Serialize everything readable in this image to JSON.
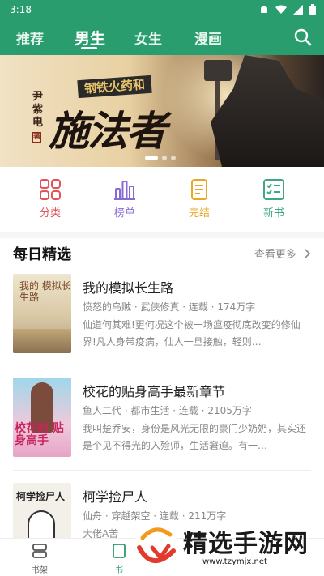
{
  "status_bar": {
    "time": "3:18"
  },
  "nav": {
    "tabs": [
      {
        "label": "推荐"
      },
      {
        "label": "男生"
      },
      {
        "label": "女生"
      },
      {
        "label": "漫画"
      }
    ],
    "active_tab": "男生"
  },
  "banner": {
    "ribbon": "钢铁火药和",
    "title": "施法者",
    "author": "尹紫电",
    "author_seal": "著",
    "dots": 3,
    "active_dot": 1
  },
  "quick_nav": [
    {
      "label": "分类",
      "icon": "grid-icon",
      "color": "#e0545a"
    },
    {
      "label": "榜单",
      "icon": "bar-chart-icon",
      "color": "#8a6bd6"
    },
    {
      "label": "完结",
      "icon": "document-icon",
      "color": "#e6a826"
    },
    {
      "label": "新书",
      "icon": "checklist-icon",
      "color": "#3fa882"
    }
  ],
  "section": {
    "title": "每日精选",
    "see_more": "查看更多"
  },
  "books": [
    {
      "title": "我的模拟长生路",
      "meta": "愤怒的乌贼 · 武侠修真 · 连载 · 174万字",
      "desc": "仙道何其难!更何况这个被一场瘟疫彻底改变的修仙界!凡人身带疫病，仙人一旦接触，轻则…",
      "cover_text": "我的 模拟长生路"
    },
    {
      "title": "校花的贴身高手最新章节",
      "meta": "鱼人二代 · 都市生活 · 连载 · 2105万字",
      "desc": "我叫楚乔安，身份是风光无限的豪门少奶奶，其实还是个见不得光的入殓师，生活窘迫。有一…",
      "cover_text": "校花的 贴身高手"
    },
    {
      "title": "柯学捡尸人",
      "meta": "仙舟 · 穿越架空 · 连载 · 211万字",
      "desc": "大佬A苦",
      "cover_text": "柯学捡尸人"
    }
  ],
  "bottom_tabs": [
    {
      "label": "书架",
      "icon": "bookshelf-icon"
    },
    {
      "label": "书",
      "icon": "book-icon"
    }
  ],
  "watermark": {
    "text": "精选手游网",
    "url": "www.tzymjx.net"
  },
  "colors": {
    "primary": "#2a9d6f"
  }
}
